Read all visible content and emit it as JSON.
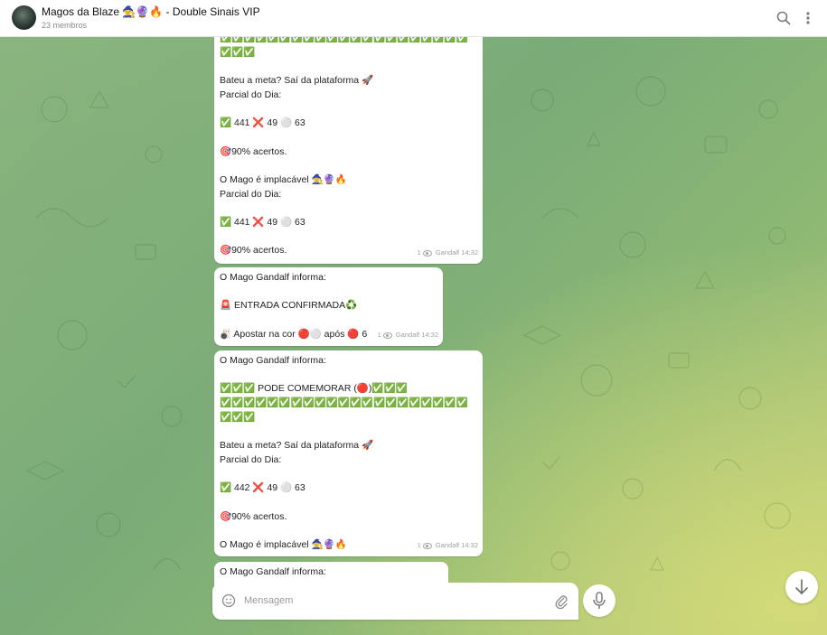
{
  "header": {
    "title": "Magos da Blaze 🧙🔮🔥 - Double Sinais VIP",
    "subtitle": "23 membros",
    "icons": [
      "search-icon",
      "more-vertical-icon"
    ]
  },
  "messages": [
    {
      "lines": [
        "✅✅✅✅✅✅✅✅✅✅✅✅✅✅✅✅✅✅✅✅✅",
        "✅✅✅",
        "",
        "Bateu a meta? Saí da plataforma 🚀",
        "Parcial do Dia:",
        "",
        "✅ 441 ❌ 49 ⚪ 63",
        "",
        "🎯90%  acertos.",
        "",
        "O Mago é implacável 🧙🔮🔥",
        "Parcial do Dia:",
        "",
        "✅ 441 ❌ 49 ⚪ 63",
        "",
        "🎯90%  acertos."
      ],
      "views": "1",
      "author": "Gandalf",
      "time": "14:32"
    },
    {
      "lines": [
        "O Mago Gandalf informa:",
        "",
        "🚨 ENTRADA CONFIRMADA♻️",
        "",
        "🎳 Apostar na cor 🔴⚪ após 🔴 6"
      ],
      "views": "1",
      "author": "Gandalf",
      "time": "14:32"
    },
    {
      "lines": [
        "O Mago Gandalf informa:",
        "",
        "✅✅✅ PODE COMEMORAR (🔴)✅✅✅",
        "✅✅✅✅✅✅✅✅✅✅✅✅✅✅✅✅✅✅✅✅✅",
        "✅✅✅",
        "",
        "Bateu a meta? Saí da plataforma 🚀",
        "Parcial do Dia:",
        "",
        "✅ 442 ❌ 49 ⚪ 63",
        "",
        "🎯90%  acertos.",
        "",
        "O Mago é implacável 🧙🔮🔥"
      ],
      "views": "1",
      "author": "Gandalf",
      "time": "14:32"
    },
    {
      "lines": [
        "O Mago Gandalf informa:"
      ]
    }
  ],
  "composer": {
    "placeholder": "Mensagem",
    "icons": [
      "emoji-icon",
      "attach-icon",
      "microphone-icon"
    ]
  },
  "scroll_button_icon": "arrow-down-icon"
}
